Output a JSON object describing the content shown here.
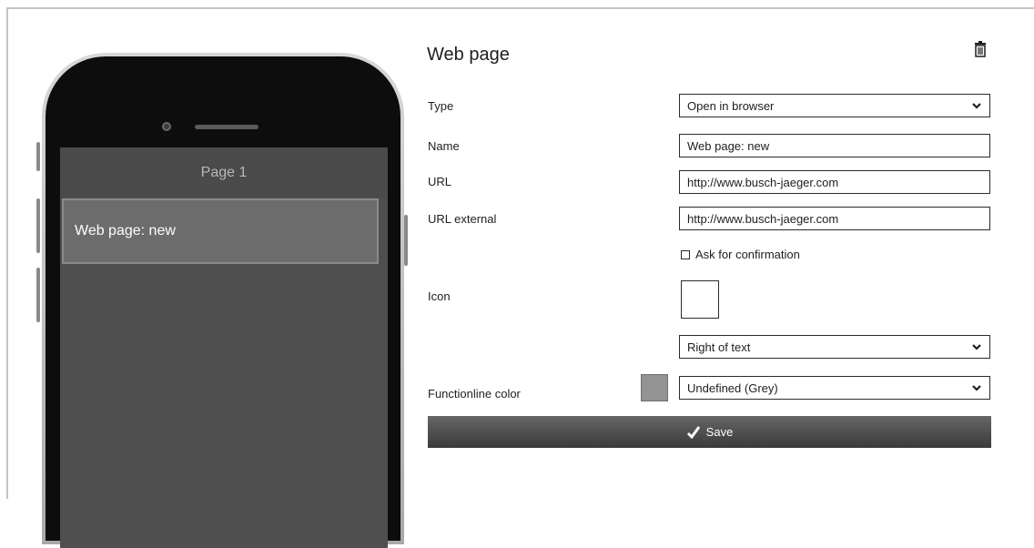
{
  "phone": {
    "page_title": "Page 1",
    "item_label": "Web page: new"
  },
  "form": {
    "title": "Web page",
    "type_label": "Type",
    "type_value": "Open in browser",
    "name_label": "Name",
    "name_value": "Web page: new",
    "url_label": "URL",
    "url_value": "http://www.busch-jaeger.com",
    "url_external_label": "URL external",
    "url_external_value": "http://www.busch-jaeger.com",
    "confirm_label": "Ask for confirmation",
    "icon_label": "Icon",
    "icon_position_value": "Right of text",
    "functionline_label": "Functionline color",
    "functionline_value": "Undefined (Grey)",
    "functionline_swatch_color": "#939393",
    "save_label": "Save"
  },
  "icons": {
    "delete": "trash-icon",
    "dropdown": "chevron-down-icon",
    "save": "check-icon"
  }
}
